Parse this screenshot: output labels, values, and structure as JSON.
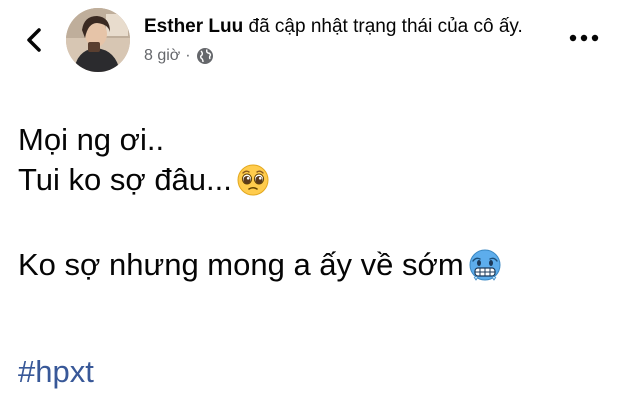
{
  "header": {
    "back_icon": "chevron-left-icon",
    "author_name": "Esther Luu",
    "action_text": " đã cập nhật trạng thái của cô ấy.",
    "timestamp": "8 giờ",
    "separator": "·",
    "privacy_icon": "globe-icon",
    "more_icon": "more-horizontal-icon"
  },
  "post": {
    "lines": [
      "Mọi ng ơi..",
      "Tui ko sợ đâu...",
      "Ko sợ nhưng mong a ấy về sớm"
    ],
    "emojis": [
      "pleading-face-icon",
      "cold-face-icon"
    ],
    "hashtag": "#hpxt"
  },
  "colors": {
    "text": "#050505",
    "meta": "#65676b",
    "hashtag": "#385898",
    "background": "#ffffff"
  }
}
